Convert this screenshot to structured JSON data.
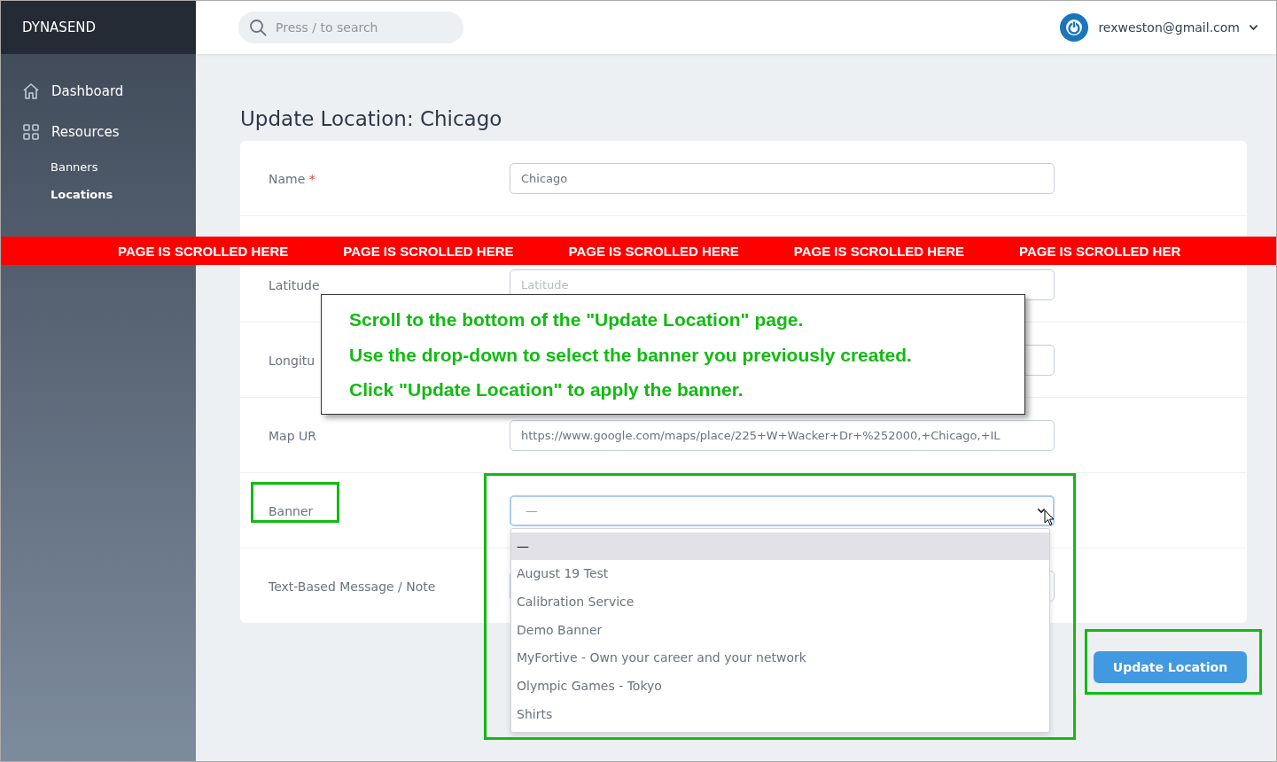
{
  "brand": "DYNASEND",
  "search": {
    "placeholder": "Press / to search"
  },
  "user": {
    "email": "rexweston@gmail.com"
  },
  "sidebar": {
    "items": [
      {
        "label": "Dashboard",
        "kind": "main",
        "selected": false
      },
      {
        "label": "Resources",
        "kind": "main",
        "selected": false
      },
      {
        "label": "Banners",
        "kind": "sub",
        "selected": false
      },
      {
        "label": "Locations",
        "kind": "sub",
        "selected": true
      }
    ]
  },
  "page_title": "Update Location: Chicago",
  "form": {
    "fields": [
      {
        "kind": "text",
        "label": "Name",
        "required_mark": "*",
        "value": "Chicago"
      },
      {
        "kind": "text",
        "label": "Latitude",
        "placeholder": "Latitude"
      },
      {
        "kind": "text",
        "label": "Longitu"
      },
      {
        "kind": "text",
        "label": "Map UR",
        "value": "https://www.google.com/maps/place/225+W+Wacker+Dr+%252000,+Chicago,+IL"
      },
      {
        "kind": "select",
        "label": "Banner",
        "value": "—",
        "options": [
          {
            "label": "—",
            "selected": true
          },
          {
            "label": "August 19 Test",
            "selected": false
          },
          {
            "label": "Calibration Service",
            "selected": false
          },
          {
            "label": "Demo Banner",
            "selected": false
          },
          {
            "label": "MyFortive - Own your career and your network",
            "selected": false
          },
          {
            "label": "Olympic Games - Tokyo",
            "selected": false
          },
          {
            "label": "Shirts",
            "selected": false
          }
        ]
      },
      {
        "kind": "text",
        "label": "Text-Based Message / Note"
      }
    ]
  },
  "submit_button": "Update Location",
  "annotations": {
    "scroll_marker": [
      "PAGE IS SCROLLED HERE",
      "PAGE IS SCROLLED HERE",
      "PAGE IS SCROLLED HERE",
      "PAGE IS SCROLLED HERE",
      "PAGE IS SCROLLED HER"
    ],
    "callout": [
      "Scroll to the bottom of the \"Update Location\" page.",
      "Use the drop-down to select the banner you previously created.",
      "Click \"Update Location\" to apply the banner."
    ]
  }
}
